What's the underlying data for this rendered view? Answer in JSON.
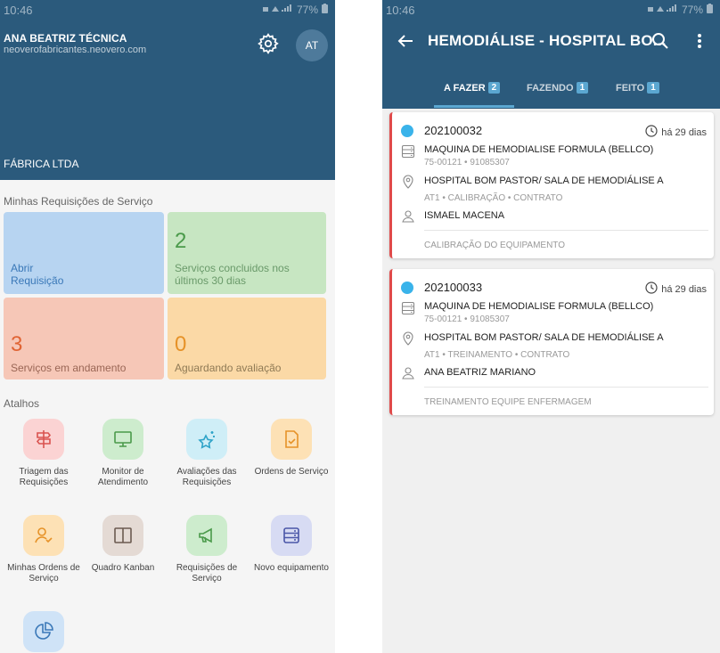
{
  "left": {
    "status": {
      "time": "10:46",
      "battery": "77%"
    },
    "user": {
      "name": "ANA BEATRIZ TÉCNICA",
      "email": "neoverofabricantes.neovero.com",
      "initials": "AT"
    },
    "company": "FÁBRICA LTDA",
    "section_requests": "Minhas Requisições de Serviço",
    "tiles": {
      "open": {
        "label_line1": "Abrir",
        "label_line2": "Requisição"
      },
      "done": {
        "count": "2",
        "label_line1": "Serviços concluidos nos",
        "label_line2": "últimos 30 dias"
      },
      "in_progress": {
        "count": "3",
        "label": "Serviços em andamento"
      },
      "awaiting": {
        "count": "0",
        "label": "Aguardando avaliação"
      }
    },
    "section_shortcuts": "Atalhos",
    "shortcuts": [
      {
        "line1": "Triagem das",
        "line2": "Requisições",
        "icon": "signpost-icon",
        "bg": "#fbd3d3",
        "fg": "#d9534f"
      },
      {
        "line1": "Monitor de",
        "line2": "Atendimento",
        "icon": "monitor-icon",
        "bg": "#cdeccd",
        "fg": "#4a9a4a"
      },
      {
        "line1": "Avaliações das",
        "line2": "Requisições",
        "icon": "star-sparkle-icon",
        "bg": "#cfeef7",
        "fg": "#2ea3c8"
      },
      {
        "line1": "Ordens de Serviço",
        "line2": "",
        "icon": "document-check-icon",
        "bg": "#fde1b5",
        "fg": "#e69228"
      },
      {
        "line1": "Minhas Ordens de",
        "line2": "Serviço",
        "icon": "user-check-icon",
        "bg": "#fde1b5",
        "fg": "#e69228"
      },
      {
        "line1": "Quadro Kanban",
        "line2": "",
        "icon": "kanban-icon",
        "bg": "#e4dad4",
        "fg": "#6b5a50"
      },
      {
        "line1": "Requisições de",
        "line2": "Serviço",
        "icon": "megaphone-icon",
        "bg": "#cdeccd",
        "fg": "#4a9a4a"
      },
      {
        "line1": "Novo equipamento",
        "line2": "",
        "icon": "server-icon",
        "bg": "#d7dbf3",
        "fg": "#4a56a8"
      },
      {
        "line1": "",
        "line2": "",
        "icon": "pie-chart-icon",
        "bg": "#cfe3f7",
        "fg": "#3a78b8"
      }
    ]
  },
  "right": {
    "status": {
      "time": "10:46",
      "battery": "77%"
    },
    "title": "HEMODIÁLISE - HOSPITAL BO...",
    "tabs": [
      {
        "label": "A FAZER",
        "count": "2"
      },
      {
        "label": "FAZENDO",
        "count": "1"
      },
      {
        "label": "FEITO",
        "count": "1"
      }
    ],
    "cards": [
      {
        "number": "202100032",
        "time": "há 29 dias",
        "equipment": "MAQUINA DE HEMODIALISE FORMULA (BELLCO)",
        "codes": "75-00121  •  91085307",
        "location": "HOSPITAL BOM PASTOR/ SALA DE HEMODIÁLISE A",
        "tags": "AT1 • CALIBRAÇÃO • CONTRATO",
        "person": "ISMAEL MACENA",
        "description": "CALIBRAÇÃO DO EQUIPAMENTO"
      },
      {
        "number": "202100033",
        "time": "há 29 dias",
        "equipment": "MAQUINA DE HEMODIALISE FORMULA (BELLCO)",
        "codes": "75-00121  •  91085307",
        "location": "HOSPITAL BOM PASTOR/ SALA DE HEMODIÁLISE A",
        "tags": "AT1 • TREINAMENTO • CONTRATO",
        "person": "ANA BEATRIZ MARIANO",
        "description": "TREINAMENTO EQUIPE ENFERMAGEM"
      }
    ]
  }
}
